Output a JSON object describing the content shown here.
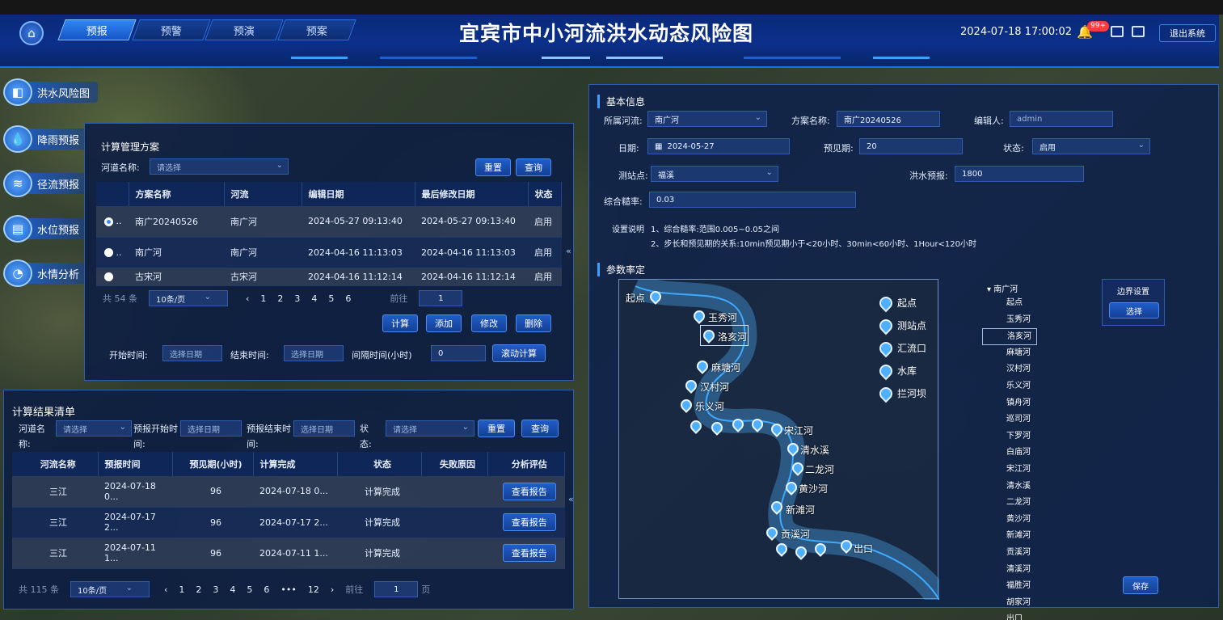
{
  "header": {
    "title": "宜宾市中小河流洪水动态风险图",
    "datetime": "2024-07-18 17:00:02",
    "badge": "99+",
    "logout": "退出系统",
    "tabs": [
      "预报",
      "预警",
      "预演",
      "预案"
    ]
  },
  "sidebar": {
    "items": [
      {
        "label": "洪水风险图",
        "icon": "flood-map-icon"
      },
      {
        "label": "降雨预报",
        "icon": "raindrop-icon"
      },
      {
        "label": "径流预报",
        "icon": "wave-icon"
      },
      {
        "label": "水位预报",
        "icon": "water-level-icon"
      },
      {
        "label": "水情分析",
        "icon": "pie-chart-icon"
      }
    ]
  },
  "plan_panel": {
    "title": "计算管理方案",
    "river_label": "河道名称:",
    "river_placeholder": "请选择",
    "reset": "重置",
    "query": "查询",
    "columns": [
      "方案名称",
      "河流",
      "编辑日期",
      "最后修改日期",
      "状态"
    ],
    "rows": [
      {
        "name": "南广20240526",
        "river": "南广河",
        "edit": "2024-05-27 09:13:40",
        "modified": "2024-05-27 09:13:40",
        "status": "启用",
        "selected": true
      },
      {
        "name": "南广河",
        "river": "南广河",
        "edit": "2024-04-16 11:13:03",
        "modified": "2024-04-16 11:13:03",
        "status": "启用",
        "selected": false
      },
      {
        "name": "古宋河",
        "river": "古宋河",
        "edit": "2024-04-16 11:12:14",
        "modified": "2024-04-16 11:12:14",
        "status": "启用",
        "selected": false
      }
    ],
    "total": "共 54 条",
    "page_size": "10条/页",
    "pages": [
      "1",
      "2",
      "3",
      "4",
      "5",
      "6"
    ],
    "goto_label": "前往",
    "goto_value": "1",
    "actions": [
      "计算",
      "添加",
      "修改",
      "删除"
    ],
    "start_label": "开始时间:",
    "end_label": "结束时间:",
    "date_placeholder": "选择日期",
    "interval_label": "间隔时间(小时)",
    "interval_value": "0",
    "roll_calc": "滚动计算"
  },
  "result_panel": {
    "title": "计算结果清单",
    "river_label": "河道名称:",
    "river_placeholder": "请选择",
    "start_label": "预报开始时间:",
    "end_label": "预报结束时间:",
    "date_placeholder": "选择日期",
    "status_label": "状态:",
    "status_placeholder": "请选择",
    "reset": "重置",
    "query": "查询",
    "columns": [
      "河流名称",
      "预报时间",
      "预见期(小时)",
      "计算完成",
      "状态",
      "失败原因",
      "分析评估"
    ],
    "rows": [
      {
        "river": "三江",
        "time": "2024-07-18 0...",
        "period": "96",
        "done": "2024-07-18 0...",
        "status": "计算完成",
        "reason": "",
        "action": "查看报告"
      },
      {
        "river": "三江",
        "time": "2024-07-17 2...",
        "period": "96",
        "done": "2024-07-17 2...",
        "status": "计算完成",
        "reason": "",
        "action": "查看报告"
      },
      {
        "river": "三江",
        "time": "2024-07-11 1...",
        "period": "96",
        "done": "2024-07-11 1...",
        "status": "计算完成",
        "reason": "",
        "action": "查看报告"
      }
    ],
    "total": "共 115 条",
    "page_size": "10条/页",
    "pages": [
      "1",
      "2",
      "3",
      "4",
      "5",
      "6",
      "•••",
      "12"
    ],
    "goto_label": "前往",
    "goto_value": "1",
    "goto_suffix": "页"
  },
  "detail": {
    "basic_title": "基本信息",
    "river_label": "所属河流:",
    "river_value": "南广河",
    "plan_label": "方案名称:",
    "plan_value": "南广20240526",
    "editor_label": "编辑人:",
    "editor_value": "admin",
    "date_label": "日期:",
    "date_value": "2024-05-27",
    "period_label": "预见期:",
    "period_value": "20",
    "status_label": "状态:",
    "status_value": "启用",
    "station_label": "测站点:",
    "station_value": "福溪",
    "flood_label": "洪水预报:",
    "flood_value": "1800",
    "rough_label": "综合糙率:",
    "rough_value": "0.03",
    "note_label": "设置说明",
    "note1": "1、综合糙率:范围0.005~0.05之间",
    "note2": "2、步长和预见期的关系:10min预见期小于<20小时、30min<60小时、1Hour<120小时",
    "param_title": "参数率定",
    "edge_title": "边界设置",
    "edge_btn": "选择",
    "save": "保存",
    "legend": [
      "起点",
      "测站点",
      "汇流口",
      "水库",
      "拦河坝"
    ],
    "map_labels": [
      "起点",
      "玉秀河",
      "洛亥河",
      "麻塘河",
      "汉村河",
      "乐义河",
      "宋江河",
      "清水溪",
      "二龙河",
      "黄沙河",
      "新滩河",
      "贡溪河",
      "出口"
    ],
    "river_list_head": "南广河",
    "river_list": [
      "起点",
      "玉秀河",
      "洛亥河",
      "麻塘河",
      "汉村河",
      "乐义河",
      "镇舟河",
      "巡司河",
      "下罗河",
      "白庙河",
      "宋江河",
      "清水溪",
      "二龙河",
      "黄沙河",
      "新滩河",
      "贡溪河",
      "清溪河",
      "福胜河",
      "胡家河",
      "出口"
    ],
    "selected_river": "洛亥河"
  }
}
